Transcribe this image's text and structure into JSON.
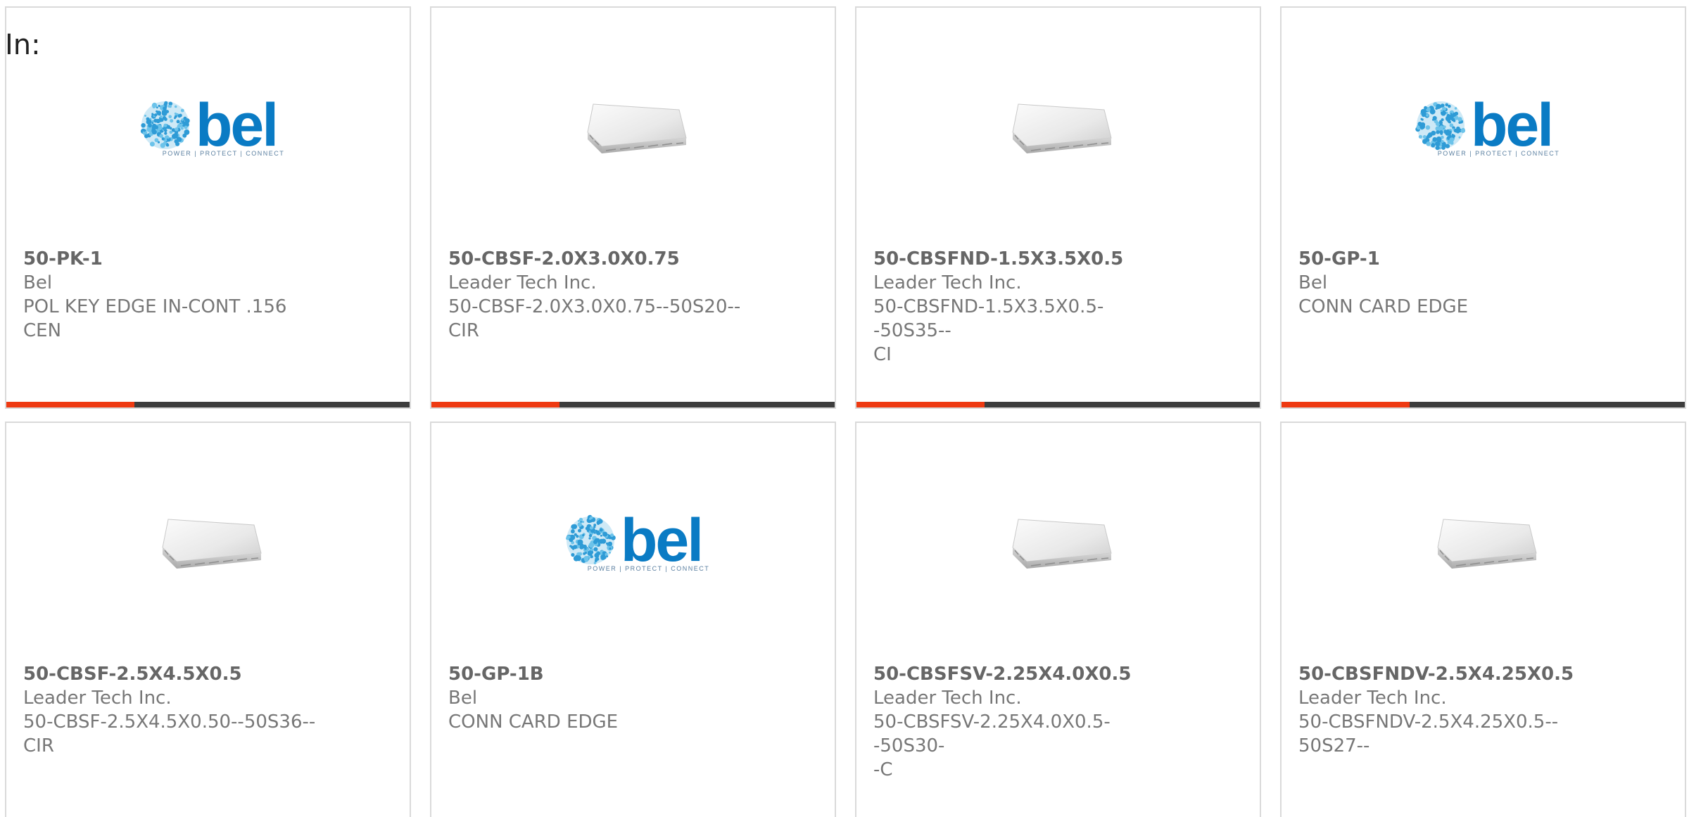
{
  "filter": {
    "in_label": "In:"
  },
  "theme": {
    "accent_color": "#ee3a12",
    "bar_color": "#3d3d3d",
    "bel_blue": "#0a7bc4"
  },
  "products": [
    {
      "part_number": "50-PK-1",
      "manufacturer": "Bel",
      "description_line1": "POL KEY EDGE IN-CONT .156",
      "description_line2": "CEN",
      "image": "bel-logo",
      "brand_word": "bel",
      "brand_tagline": "POWER | PROTECT | CONNECT"
    },
    {
      "part_number": "50-CBSF-2.0X3.0X0.75",
      "manufacturer": "Leader Tech Inc.",
      "description_line1": "50-CBSF-2.0X3.0X0.75--50S20--",
      "description_line2": "CIR",
      "image": "shield-can-photo"
    },
    {
      "part_number": "50-CBSFND-1.5X3.5X0.5",
      "manufacturer": "Leader Tech Inc.",
      "description_line1": "50-CBSFND-1.5X3.5X0.5--50S35--",
      "description_line2": "CI",
      "image": "shield-can-photo"
    },
    {
      "part_number": "50-GP-1",
      "manufacturer": "Bel",
      "description_line1": "CONN CARD EDGE",
      "description_line2": "",
      "image": "bel-logo",
      "brand_word": "bel",
      "brand_tagline": "POWER | PROTECT | CONNECT"
    },
    {
      "part_number": "50-CBSF-2.5X4.5X0.5",
      "manufacturer": "Leader Tech Inc.",
      "description_line1": "50-CBSF-2.5X4.5X0.50--50S36--",
      "description_line2": "CIR",
      "image": "shield-can-photo"
    },
    {
      "part_number": "50-GP-1B",
      "manufacturer": "Bel",
      "description_line1": "CONN CARD EDGE",
      "description_line2": "",
      "image": "bel-logo",
      "brand_word": "bel",
      "brand_tagline": "POWER | PROTECT | CONNECT"
    },
    {
      "part_number": "50-CBSFSV-2.25X4.0X0.5",
      "manufacturer": "Leader Tech Inc.",
      "description_line1": "50-CBSFSV-2.25X4.0X0.5--50S30-",
      "description_line2": "-C",
      "image": "shield-can-photo"
    },
    {
      "part_number": "50-CBSFNDV-2.5X4.25X0.5",
      "manufacturer": "Leader Tech Inc.",
      "description_line1": "50-CBSFNDV-2.5X4.25X0.5--",
      "description_line2": "50S27--",
      "image": "shield-can-photo"
    }
  ]
}
